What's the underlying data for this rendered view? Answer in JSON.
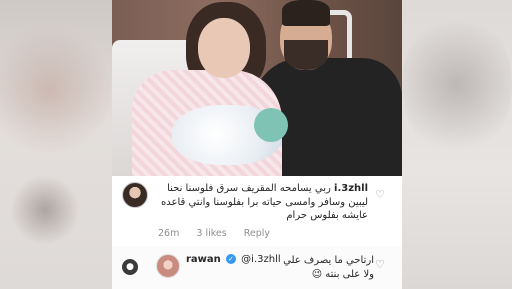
{
  "comment1": {
    "username": "i.3zhll",
    "text": "ربي يسامحه المقريف سرق فلوسنا نحنا ليبين وسافر وامسى حياته برا بفلوسنا وانتي قاعده عايشه بفلوس حرام",
    "time": "26m",
    "likes": "3 likes",
    "reply": "Reply"
  },
  "comment2": {
    "username": "rawan",
    "mention": "@i.3zhll",
    "text": "ارتاحي ما يصرف علي ولا على بنته 😉",
    "verified_icon": "✓"
  },
  "icons": {
    "heart": "♡",
    "person": "●"
  }
}
